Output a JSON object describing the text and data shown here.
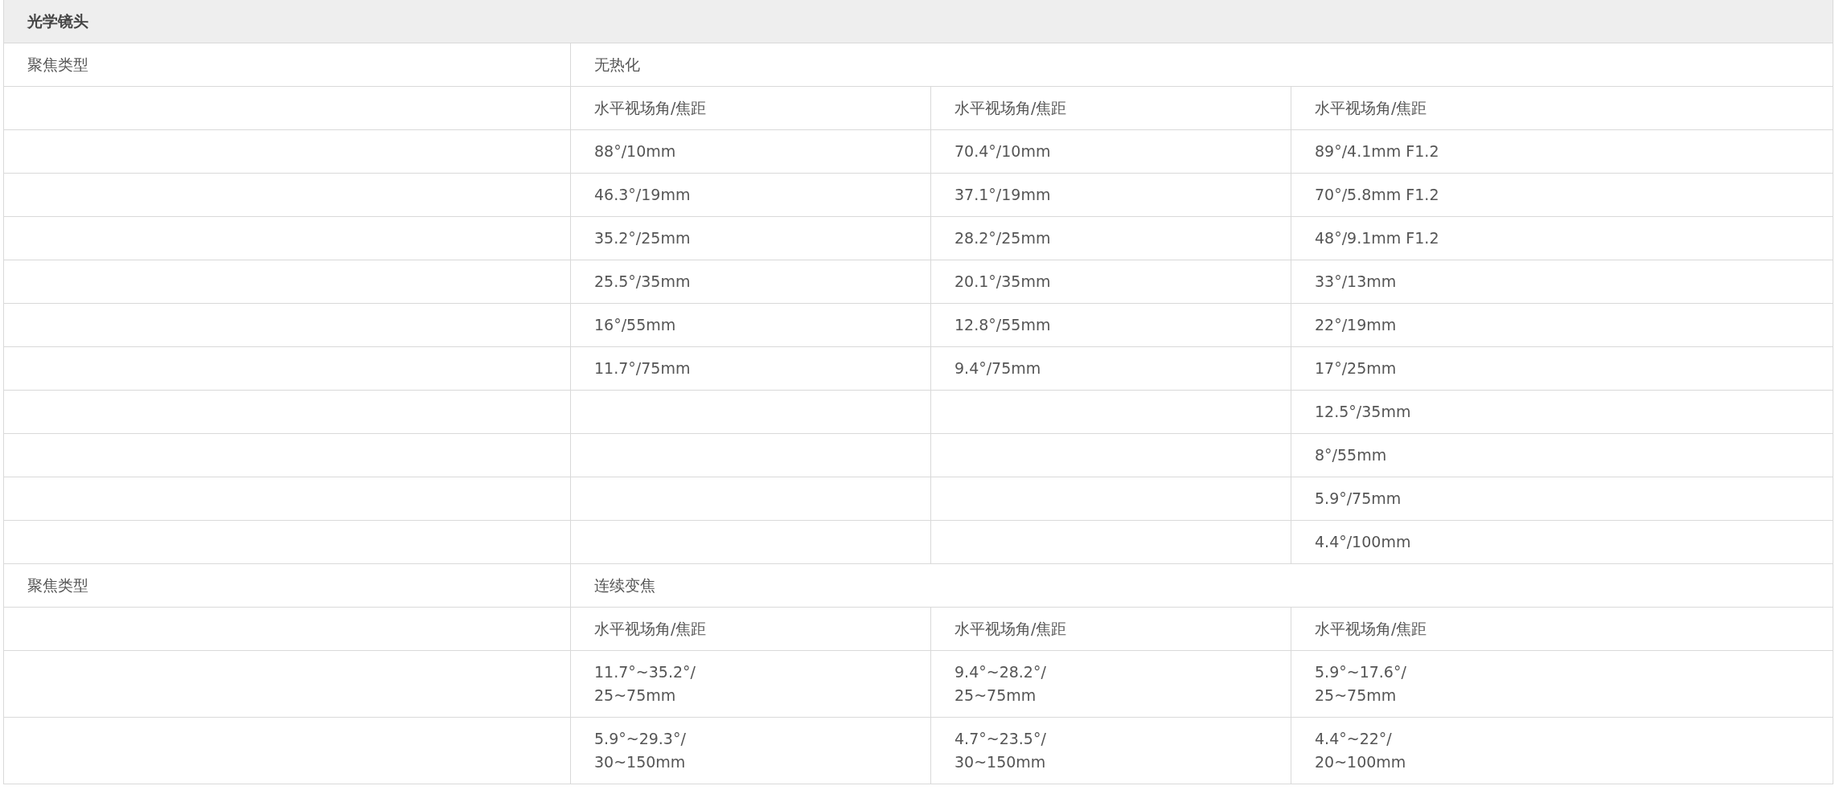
{
  "section": {
    "title": "光学镜头"
  },
  "groups": [
    {
      "label": "聚焦类型",
      "value": "无热化",
      "rows": [
        [
          "水平视场角/焦距",
          "水平视场角/焦距",
          "水平视场角/焦距"
        ],
        [
          "88°/10mm",
          "70.4°/10mm",
          "89°/4.1mm F1.2"
        ],
        [
          "46.3°/19mm",
          "37.1°/19mm",
          "70°/5.8mm F1.2"
        ],
        [
          "35.2°/25mm",
          "28.2°/25mm",
          "48°/9.1mm F1.2"
        ],
        [
          "25.5°/35mm",
          "20.1°/35mm",
          "33°/13mm"
        ],
        [
          "16°/55mm",
          "12.8°/55mm",
          "22°/19mm"
        ],
        [
          "11.7°/75mm",
          "9.4°/75mm",
          "17°/25mm"
        ],
        [
          null,
          null,
          "12.5°/35mm"
        ],
        [
          null,
          null,
          "8°/55mm"
        ],
        [
          null,
          null,
          "5.9°/75mm"
        ],
        [
          null,
          null,
          "4.4°/100mm"
        ]
      ]
    },
    {
      "label": "聚焦类型",
      "value": "连续变焦",
      "rows": [
        [
          "水平视场角/焦距",
          "水平视场角/焦距",
          "水平视场角/焦距"
        ],
        [
          "11.7°~35.2°/\n25~75mm",
          "9.4°~28.2°/\n25~75mm",
          "5.9°~17.6°/\n25~75mm"
        ],
        [
          "5.9°~29.3°/\n30~150mm",
          "4.7°~23.5°/\n30~150mm",
          "4.4°~22°/\n20~100mm"
        ]
      ]
    }
  ]
}
